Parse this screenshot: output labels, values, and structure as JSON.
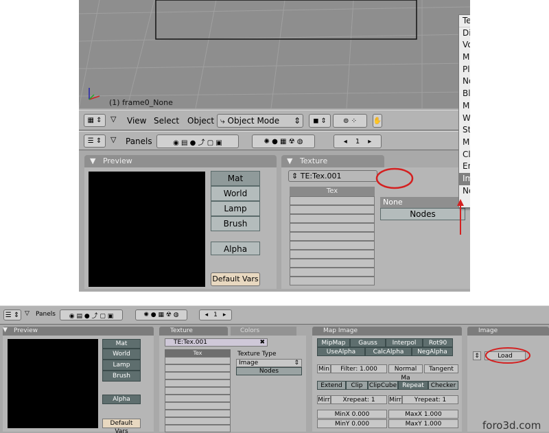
{
  "top": {
    "viewport": {
      "object_label": "(1) frame0_None"
    },
    "header": {
      "menus": [
        "View",
        "Select",
        "Object"
      ],
      "mode": "Object Mode"
    },
    "buttons_header": {
      "label": "Panels",
      "frame": "1"
    },
    "preview": {
      "title": "Preview",
      "tabs": [
        "Mat",
        "World",
        "Lamp",
        "Brush"
      ],
      "alpha": "Alpha",
      "default_vars": "Default Vars"
    },
    "texture": {
      "title": "Texture",
      "name": "TE:Tex.001",
      "column": "Tex",
      "type_value": "None",
      "nodes": "Nodes"
    },
    "menu": {
      "title": "Texture Type",
      "items": [
        "DistortedNoise",
        "Voronoi",
        "Musgrave",
        "Plugin",
        "Noise",
        "Blend",
        "Magic",
        "Wood",
        "Stucci",
        "Marble",
        "Clouds",
        "EnvMap",
        "Image",
        "None"
      ],
      "highlight": "Image"
    }
  },
  "bottom": {
    "header": {
      "label": "Panels",
      "frame": "1"
    },
    "preview": {
      "title": "Preview",
      "tabs": [
        "Mat",
        "World",
        "Lamp",
        "Brush"
      ],
      "alpha": "Alpha",
      "default_vars": "Default Vars"
    },
    "texture": {
      "title": "Texture",
      "tab2": "Colors",
      "name": "TE:Tex.001",
      "column": "Tex",
      "type_label": "Texture Type",
      "type_value": "Image",
      "nodes": "Nodes"
    },
    "map_image": {
      "title": "Map Image",
      "row1": [
        "MipMap",
        "Gauss",
        "Interpol",
        "Rot90"
      ],
      "row2": [
        "UseAlpha",
        "CalcAlpha",
        "NegAlpha"
      ],
      "min": "Min",
      "filter": "Filter: 1.000",
      "normal": "Normal Ma",
      "tangent": "Tangent",
      "row4": [
        "Extend",
        "Clip",
        "ClipCube",
        "Repeat",
        "Checker"
      ],
      "mirr": "Mirr",
      "xrepeat": "Xrepeat: 1",
      "yrepeat": "Yrepeat: 1",
      "minx": "MinX 0.000",
      "maxx": "MaxX 1.000",
      "miny": "MinY 0.000",
      "maxy": "MaxY 1.000"
    },
    "image": {
      "title": "Image",
      "load": "Load"
    }
  },
  "watermark": "foro3d.com",
  "colors": {
    "highlight_circle": "#d42020",
    "arrow": "#d42020",
    "menu_highlight": "#808080"
  }
}
